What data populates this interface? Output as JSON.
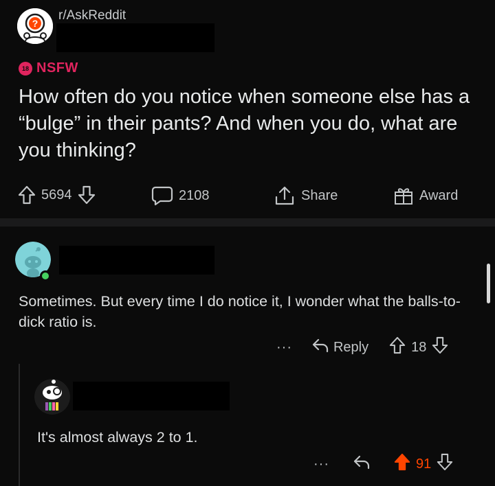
{
  "post": {
    "subreddit": "r/AskReddit",
    "subreddit_icon": "askreddit-snoo-icon",
    "nsfw_badge_number": "18",
    "nsfw_label": "NSFW",
    "title": "How often do you notice when someone else has a “bulge” in their pants? And when you do, what are you thinking?",
    "upvotes": "5694",
    "comments": "2108",
    "share_label": "Share",
    "award_label": "Award"
  },
  "comments": [
    {
      "avatar_icon": "snoo-avatar-icon",
      "text": "Sometimes. But every time I do notice it, I wonder what the balls-to-dick ratio is.",
      "more": "···",
      "reply_label": "Reply",
      "score": "18",
      "online": true
    },
    {
      "avatar_icon": "snoo-avatar-icon",
      "text": "It's almost always 2 to 1.",
      "more": "···",
      "score": "91",
      "upvoted": true
    }
  ],
  "colors": {
    "background": "#0b0b0b",
    "nsfw": "#e0245e",
    "upvoted": "#ff4500",
    "online": "#46d160"
  }
}
